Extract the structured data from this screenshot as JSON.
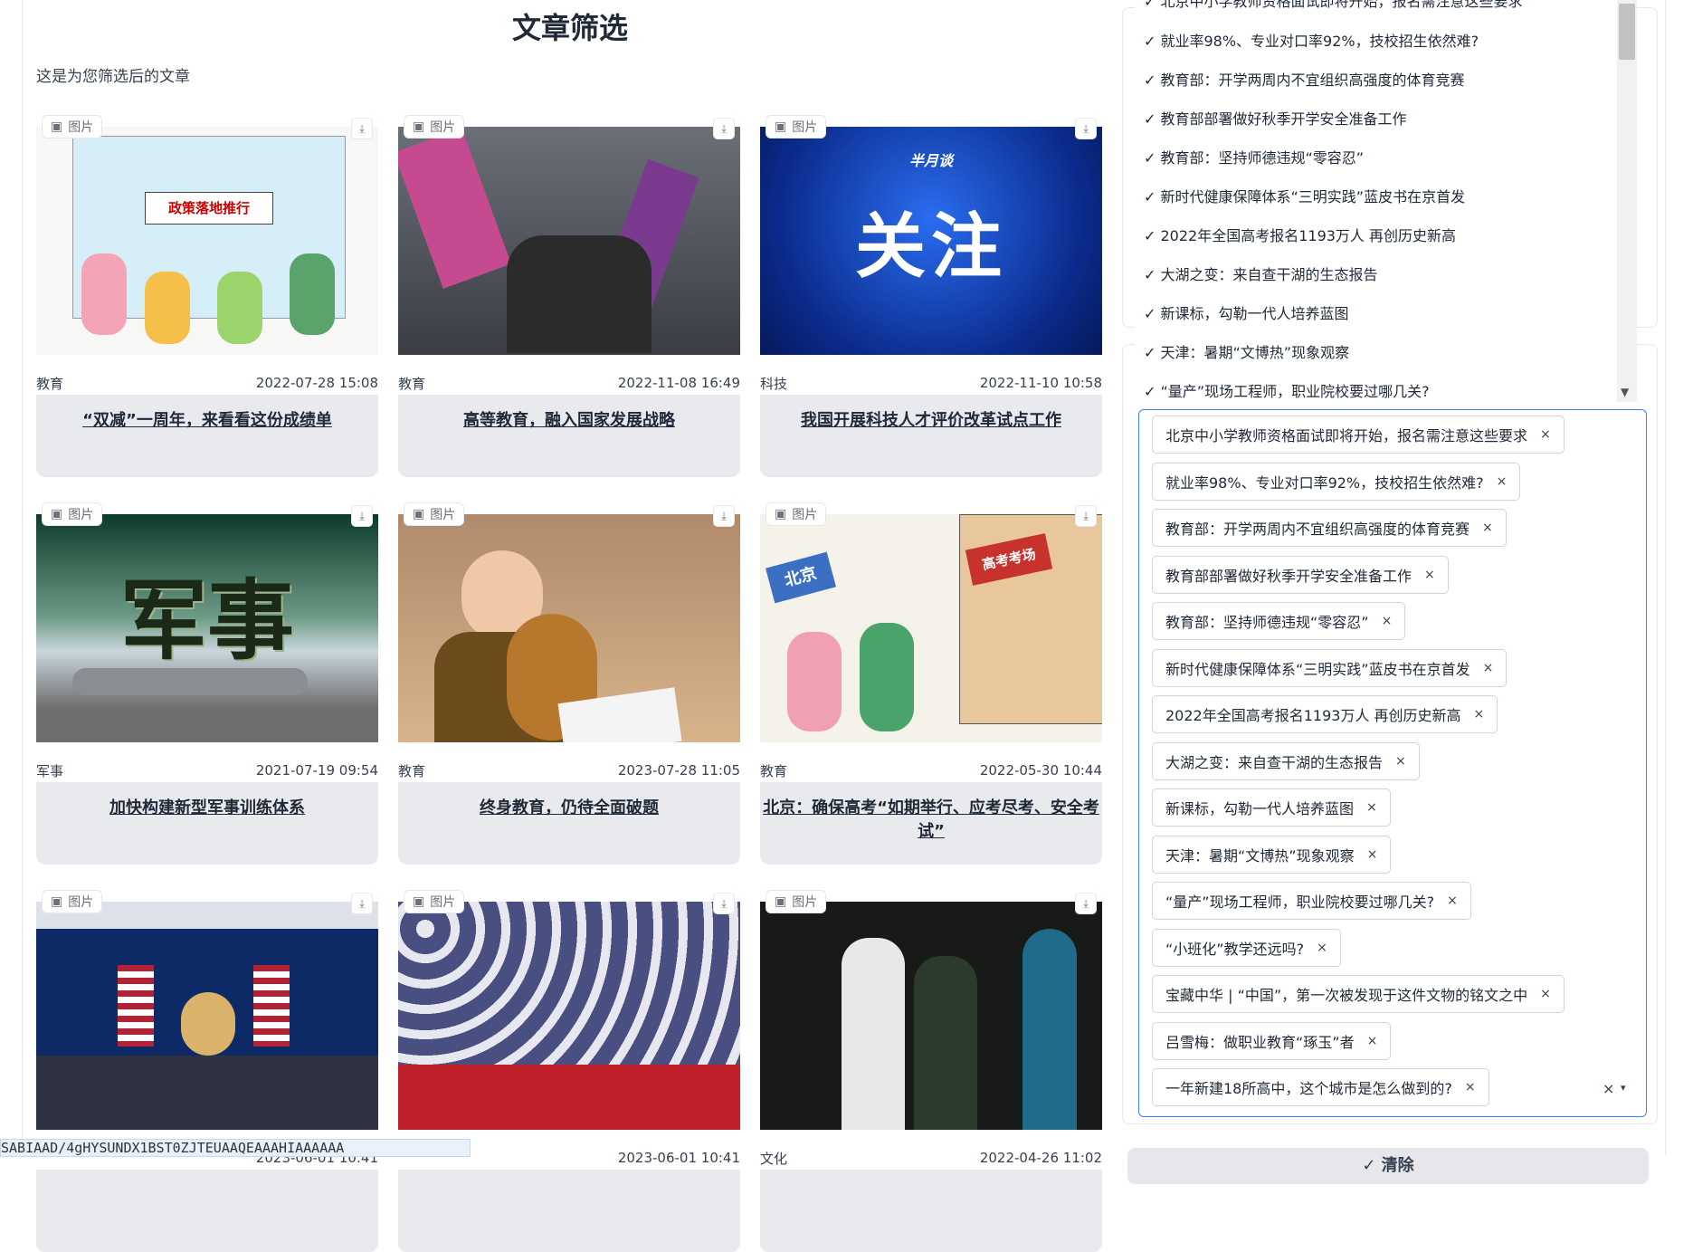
{
  "page": {
    "title": "文章筛选",
    "subtitle": "这是为您筛选后的文章"
  },
  "labels": {
    "image_chip": "图片",
    "download_icon": "download-icon"
  },
  "cards": [
    {
      "category": "教育",
      "date": "2022-07-28 15:08",
      "title": "“双减”一周年，来看看这份成绩单"
    },
    {
      "category": "教育",
      "date": "2022-11-08 16:49",
      "title": "高等教育，融入国家发展战略"
    },
    {
      "category": "科技",
      "date": "2022-11-10 10:58",
      "title": "我国开展科技人才评价改革试点工作",
      "img_text": "关注",
      "img_brand": "半月谈"
    },
    {
      "category": "军事",
      "date": "2021-07-19 09:54",
      "title": "加快构建新型军事训练体系",
      "img_text": "军事"
    },
    {
      "category": "教育",
      "date": "2023-07-28 11:05",
      "title": "终身教育，仍待全面破题"
    },
    {
      "category": "教育",
      "date": "2022-05-30 10:44",
      "title": "北京：确保高考“如期举行、应考尽考、安全考试”",
      "img_text1": "北京",
      "img_text2": "高考考场"
    },
    {
      "category": "",
      "date": "2023-06-01 10:41",
      "title": ""
    },
    {
      "category": "",
      "date": "2023-06-01 10:41",
      "title": ""
    },
    {
      "category": "文化",
      "date": "2022-04-26 11:02",
      "title": ""
    }
  ],
  "dropdown_options": [
    "就业率98%、专业对口率92%，技校招生依然难?",
    "教育部：开学两周内不宜组织高强度的体育竞赛",
    "教育部部署做好秋季开学安全准备工作",
    "教育部：坚持师德违规“零容忍”",
    "新时代健康保障体系“三明实践”蓝皮书在京首发",
    "2022年全国高考报名1193万人 再创历史新高",
    "大湖之变：来自查干湖的生态报告",
    "新课标，勾勒一代人培养蓝图",
    "天津：暑期“文博热”现象观察",
    "“量产”现场工程师，职业院校要过哪几关?"
  ],
  "dropdown_top_partial": "北京中小学教师资格面试即将开始，报名需注意这些要求",
  "check_mark": "✓",
  "selected_tags": [
    "北京中小学教师资格面试即将开始，报名需注意这些要求",
    "就业率98%、专业对口率92%，技校招生依然难?",
    "教育部：开学两周内不宜组织高强度的体育竞赛",
    "教育部部署做好秋季开学安全准备工作",
    "教育部：坚持师德违规“零容忍”",
    "新时代健康保障体系“三明实践”蓝皮书在京首发",
    "2022年全国高考报名1193万人 再创历史新高",
    "大湖之变：来自查干湖的生态报告",
    "新课标，勾勒一代人培养蓝图",
    "天津：暑期“文博热”现象观察",
    "“量产”现场工程师，职业院校要过哪几关?",
    "“小班化”教学还远吗?",
    "宝藏中华 | “中国”，第一次被发现于这件文物的铭文之中",
    "吕雪梅：做职业教育“琢玉”者",
    "一年新建18所高中，这个城市是怎么做到的?"
  ],
  "tag_close": "×",
  "clear_all_icon": "×",
  "expand_icon": "▾",
  "clear_button": "✓ 清除",
  "status_bar_text": "SABIAAD/4gHYSUNDX1BST0ZJTEUAAQEAAAHIAAAAAA"
}
